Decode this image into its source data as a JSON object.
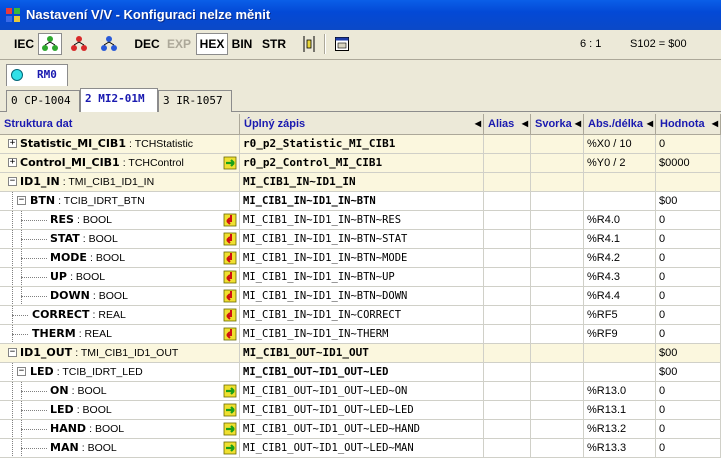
{
  "window": {
    "title": "Nastavení V/V - Konfiguraci nelze měnit"
  },
  "toolbar": {
    "iec": "IEC",
    "dec": "DEC",
    "exp": "EXP",
    "hex": "HEX",
    "bin": "BIN",
    "str": "STR",
    "icons": [
      "tree-green-icon",
      "tree-red-icon",
      "tree-blue-icon",
      "insert-icon",
      "window-icon"
    ],
    "ratio": "6 : 1",
    "status": "S102 = $00"
  },
  "rm": {
    "label": "RM0",
    "color": "#31E0E8"
  },
  "module_tabs": [
    {
      "label": "0 CP-1004",
      "active": false
    },
    {
      "label": "2 MI2-01M",
      "active": true
    },
    {
      "label": "3 IR-1057",
      "active": false
    }
  ],
  "columns": {
    "struktura": "Struktura dat",
    "zapis": "Úplný zápis",
    "alias": "Alias",
    "svorka": "Svorka",
    "abs": "Abs./délka",
    "hodnota": "Hodnota"
  },
  "rows": [
    {
      "name": "Statistic_MI_CIB1",
      "type": ": TCHStatistic",
      "full": "r0_p2_Statistic_MI_CIB1",
      "alias": "",
      "svorka": "",
      "abs": "%X0 / 10",
      "value": "0",
      "level": 0,
      "kind": "collapsed",
      "dir": "none"
    },
    {
      "name": "Control_MI_CIB1",
      "type": ": TCHControl",
      "full": "r0_p2_Control_MI_CIB1",
      "alias": "",
      "svorka": "",
      "abs": "%Y0 / 2",
      "value": "$0000",
      "level": 0,
      "kind": "collapsed",
      "dir": "out"
    },
    {
      "name": "ID1_IN",
      "type": ": TMI_CIB1_ID1_IN",
      "full": "MI_CIB1_IN~ID1_IN",
      "alias": "",
      "svorka": "",
      "abs": "",
      "value": "",
      "level": 0,
      "kind": "struct",
      "dir": "none"
    },
    {
      "name": "BTN",
      "type": ": TCIB_IDRT_BTN",
      "full": "MI_CIB1_IN~ID1_IN~BTN",
      "alias": "",
      "svorka": "",
      "abs": "",
      "value": "$00",
      "level": 1,
      "kind": "sub",
      "dir": "none"
    },
    {
      "name": "RES",
      "type": ": BOOL",
      "full": "MI_CIB1_IN~ID1_IN~BTN~RES",
      "alias": "",
      "svorka": "",
      "abs": "%R4.0",
      "value": "0",
      "level": 2,
      "kind": "leaf",
      "dir": "in"
    },
    {
      "name": "STAT",
      "type": ": BOOL",
      "full": "MI_CIB1_IN~ID1_IN~BTN~STAT",
      "alias": "",
      "svorka": "",
      "abs": "%R4.1",
      "value": "0",
      "level": 2,
      "kind": "leaf",
      "dir": "in"
    },
    {
      "name": "MODE",
      "type": ": BOOL",
      "full": "MI_CIB1_IN~ID1_IN~BTN~MODE",
      "alias": "",
      "svorka": "",
      "abs": "%R4.2",
      "value": "0",
      "level": 2,
      "kind": "leaf",
      "dir": "in"
    },
    {
      "name": "UP",
      "type": ": BOOL",
      "full": "MI_CIB1_IN~ID1_IN~BTN~UP",
      "alias": "",
      "svorka": "",
      "abs": "%R4.3",
      "value": "0",
      "level": 2,
      "kind": "leaf",
      "dir": "in"
    },
    {
      "name": "DOWN",
      "type": ": BOOL",
      "full": "MI_CIB1_IN~ID1_IN~BTN~DOWN",
      "alias": "",
      "svorka": "",
      "abs": "%R4.4",
      "value": "0",
      "level": 2,
      "kind": "leaf",
      "dir": "in"
    },
    {
      "name": "CORRECT",
      "type": ": REAL",
      "full": "MI_CIB1_IN~ID1_IN~CORRECT",
      "alias": "",
      "svorka": "",
      "abs": "%RF5",
      "value": "0",
      "level": 1,
      "kind": "leaf",
      "dir": "in"
    },
    {
      "name": "THERM",
      "type": ": REAL",
      "full": "MI_CIB1_IN~ID1_IN~THERM",
      "alias": "",
      "svorka": "",
      "abs": "%RF9",
      "value": "0",
      "level": 1,
      "kind": "leaf",
      "dir": "in"
    },
    {
      "name": "ID1_OUT",
      "type": ": TMI_CIB1_ID1_OUT",
      "full": "MI_CIB1_OUT~ID1_OUT",
      "alias": "",
      "svorka": "",
      "abs": "",
      "value": "$00",
      "level": 0,
      "kind": "struct",
      "dir": "none"
    },
    {
      "name": "LED",
      "type": ": TCIB_IDRT_LED",
      "full": "MI_CIB1_OUT~ID1_OUT~LED",
      "alias": "",
      "svorka": "",
      "abs": "",
      "value": "$00",
      "level": 1,
      "kind": "sub",
      "dir": "none"
    },
    {
      "name": "ON",
      "type": ": BOOL",
      "full": "MI_CIB1_OUT~ID1_OUT~LED~ON",
      "alias": "",
      "svorka": "",
      "abs": "%R13.0",
      "value": "0",
      "level": 2,
      "kind": "leaf",
      "dir": "out"
    },
    {
      "name": "LED",
      "type": ": BOOL",
      "full": "MI_CIB1_OUT~ID1_OUT~LED~LED",
      "alias": "",
      "svorka": "",
      "abs": "%R13.1",
      "value": "0",
      "level": 2,
      "kind": "leaf",
      "dir": "out"
    },
    {
      "name": "HAND",
      "type": ": BOOL",
      "full": "MI_CIB1_OUT~ID1_OUT~LED~HAND",
      "alias": "",
      "svorka": "",
      "abs": "%R13.2",
      "value": "0",
      "level": 2,
      "kind": "leaf",
      "dir": "out"
    },
    {
      "name": "MAN",
      "type": ": BOOL",
      "full": "MI_CIB1_OUT~ID1_OUT~LED~MAN",
      "alias": "",
      "svorka": "",
      "abs": "%R13.3",
      "value": "0",
      "level": 2,
      "kind": "leaf",
      "dir": "out"
    }
  ]
}
